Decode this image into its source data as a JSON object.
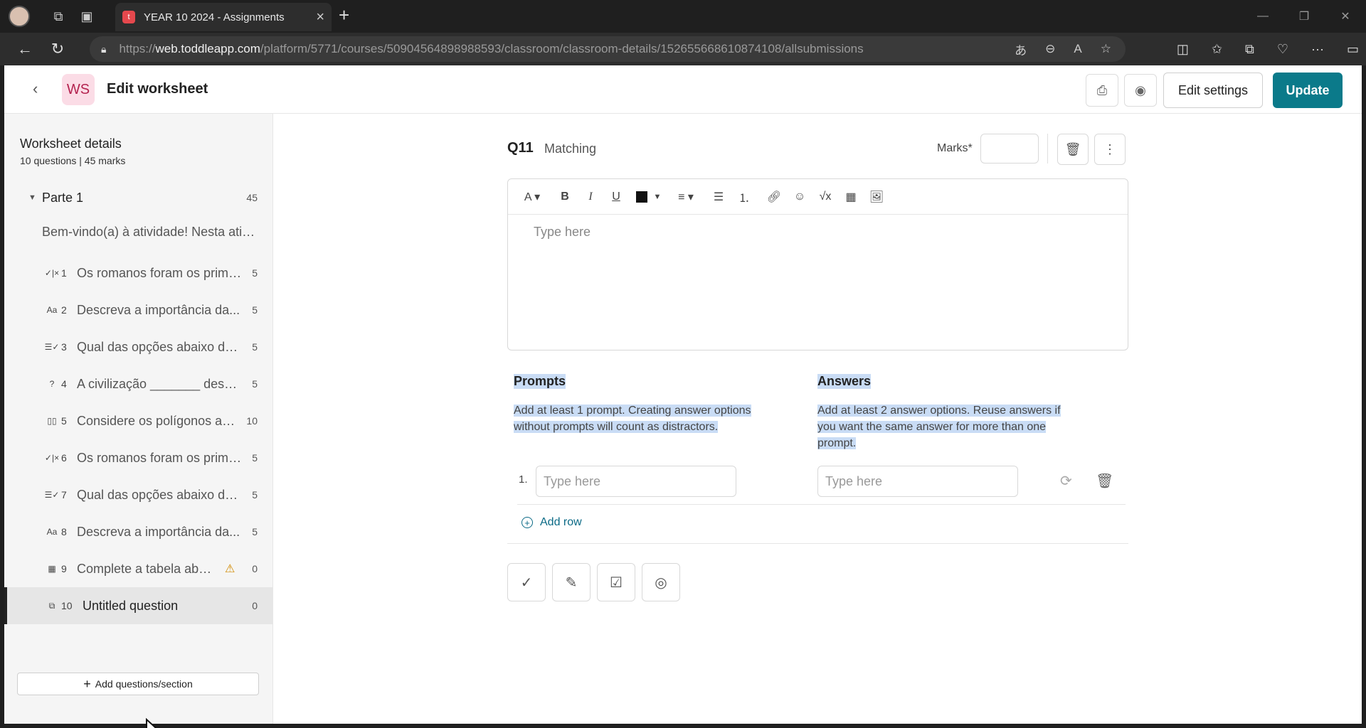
{
  "browser": {
    "tab_title": "YEAR 10 2024 - Assignments",
    "tab_favicon": "t",
    "url_prefix": "https://",
    "url_domain": "web.toddleapp.com",
    "url_path": "/platform/5771/courses/50904564898988593/classroom/classroom-details/152655668610874108/allsubmissions"
  },
  "header": {
    "badge": "WS",
    "title": "Edit worksheet",
    "edit_settings_label": "Edit settings",
    "update_label": "Update",
    "accent_color": "#0b7a8a"
  },
  "sidebar": {
    "title": "Worksheet details",
    "subtitle": "10 questions | 45 marks",
    "section": {
      "name": "Parte 1",
      "marks": "45"
    },
    "intro": "Bem-vindo(a) à atividade! Nesta atividade...",
    "questions": [
      {
        "type_icon": "✓|×",
        "num": "1",
        "label": "Os romanos foram os primeiros...",
        "marks": "5"
      },
      {
        "type_icon": "Aa",
        "num": "2",
        "label": "Descreva a importância da...",
        "marks": "5"
      },
      {
        "type_icon": "☰✓",
        "num": "3",
        "label": "Qual das opções abaixo des...",
        "marks": "5"
      },
      {
        "type_icon": "?",
        "num": "4",
        "label": "A civilização _______ desenvolveu",
        "marks": "5"
      },
      {
        "type_icon": "▯▯",
        "num": "5",
        "label": "Considere os polígonos abaixo",
        "marks": "10"
      },
      {
        "type_icon": "✓|×",
        "num": "6",
        "label": "Os romanos foram os primeiros...",
        "marks": "5"
      },
      {
        "type_icon": "☰✓",
        "num": "7",
        "label": "Qual das opções abaixo des...",
        "marks": "5"
      },
      {
        "type_icon": "Aa",
        "num": "8",
        "label": "Descreva a importância da...",
        "marks": "5"
      },
      {
        "type_icon": "▦",
        "num": "9",
        "label": "Complete a tabela abaixo",
        "marks": "0"
      },
      {
        "type_icon": "⧉",
        "num": "10",
        "label": "Untitled question",
        "marks": "0"
      }
    ],
    "add_label": "Add questions/section"
  },
  "question": {
    "number": "Q11",
    "type": "Matching",
    "marks_label": "Marks*",
    "editor_placeholder": "Type here",
    "prompts_title": "Prompts",
    "prompts_help": "Add at least 1 prompt. Creating answer options without prompts will count as distractors.",
    "answers_title": "Answers",
    "answers_help": "Add at least 2 answer options. Reuse answers if you want the same answer for more than one prompt.",
    "row_number": "1.",
    "prompt_placeholder": "Type here",
    "answer_placeholder": "Type here",
    "add_row_label": "Add row"
  }
}
